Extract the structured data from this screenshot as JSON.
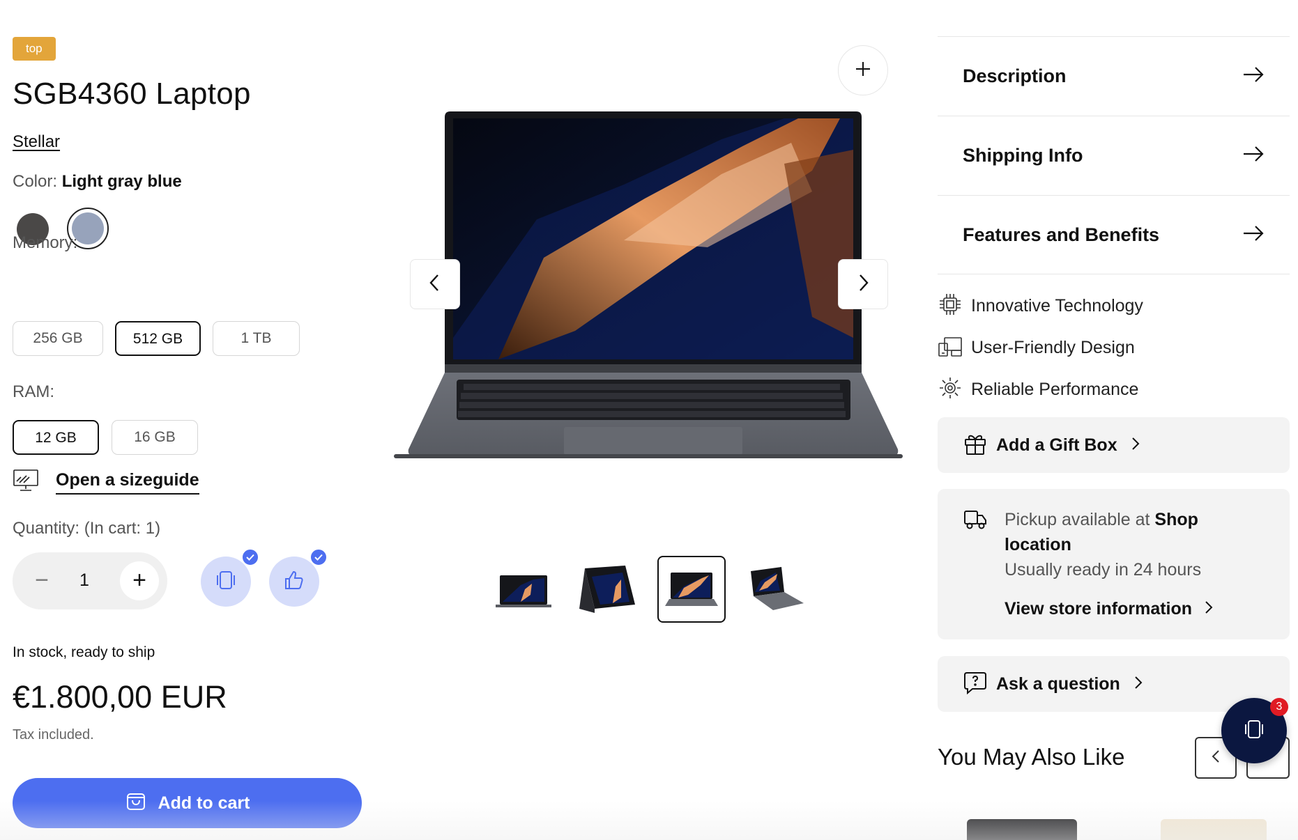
{
  "product": {
    "badge": "top",
    "title": "SGB4360 Laptop",
    "vendor": "Stellar",
    "color_label": "Color:",
    "color_value": "Light gray blue",
    "swatches": [
      {
        "name": "Dark gray",
        "hex": "#4a4847"
      },
      {
        "name": "Light gray blue",
        "hex": "#97a3bb",
        "selected": true
      }
    ],
    "memory_label": "Memory:",
    "memory_options": [
      "256 GB",
      "512 GB",
      "1 TB"
    ],
    "memory_selected": "512 GB",
    "ram_label": "RAM:",
    "ram_options": [
      "12 GB",
      "16 GB"
    ],
    "ram_selected": "12 GB",
    "sizeguide_label": "Open a sizeguide",
    "quantity_label": "Quantity: (In cart: 1)",
    "quantity_value": "1",
    "stock_text": "In stock, ready to ship",
    "price": "€1.800,00 EUR",
    "tax_text": "Tax included.",
    "add_to_cart_label": "Add to cart"
  },
  "gallery": {
    "thumbnails": [
      "thumb-1",
      "thumb-2",
      "thumb-3",
      "thumb-4"
    ],
    "selected_index": 3
  },
  "details": {
    "accordions": [
      "Description",
      "Shipping Info",
      "Features and Benefits"
    ],
    "features": [
      {
        "icon": "chip-icon",
        "label": "Innovative Technology"
      },
      {
        "icon": "devices-icon",
        "label": "User-Friendly Design"
      },
      {
        "icon": "gear-icon",
        "label": "Reliable Performance"
      }
    ],
    "gift_label": "Add a Gift Box",
    "pickup": {
      "prefix": "Pickup available at ",
      "location_line1": "Shop",
      "location_line2": "location",
      "ready_text": "Usually ready in 24 hours",
      "store_link": "View store information"
    },
    "ask_label": "Ask a question",
    "recommend_title": "You May Also Like"
  },
  "floating": {
    "badge_count": "3"
  },
  "colors": {
    "accent": "#4d6ef0",
    "badge": "#e3a53a",
    "dark_navy": "#0b1740",
    "notify": "#e01b24"
  }
}
